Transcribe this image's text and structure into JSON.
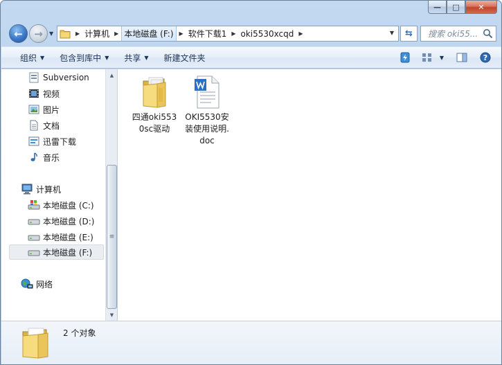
{
  "window": {
    "caption_buttons": {
      "minimize": "—",
      "maximize": "□",
      "close": "✕"
    }
  },
  "address_bar": {
    "breadcrumbs": [
      "计算机",
      "本地磁盘 (F:)",
      "软件下载1",
      "oki5530xcqd"
    ]
  },
  "search": {
    "placeholder": "搜索 oki55..."
  },
  "toolbar": {
    "organize": "组织",
    "include_in_library": "包含到库中",
    "share": "共享",
    "new_folder": "新建文件夹"
  },
  "nav_pane": {
    "items": [
      {
        "label": "Subversion",
        "icon": "subversion-icon"
      },
      {
        "label": "视频",
        "icon": "video-icon"
      },
      {
        "label": "图片",
        "icon": "pictures-icon"
      },
      {
        "label": "文档",
        "icon": "documents-icon"
      },
      {
        "label": "迅雷下载",
        "icon": "thunder-download-icon"
      },
      {
        "label": "音乐",
        "icon": "music-icon"
      },
      {
        "label": "计算机",
        "icon": "computer-icon"
      },
      {
        "label": "本地磁盘 (C:)",
        "icon": "system-drive-icon"
      },
      {
        "label": "本地磁盘 (D:)",
        "icon": "drive-icon"
      },
      {
        "label": "本地磁盘 (E:)",
        "icon": "drive-icon"
      },
      {
        "label": "本地磁盘 (F:)",
        "icon": "drive-icon",
        "selected": true
      },
      {
        "label": "网络",
        "icon": "network-icon"
      }
    ]
  },
  "files": [
    {
      "label": "四通oki5530sc驱动",
      "type": "folder",
      "icon": "folder-icon"
    },
    {
      "label": "OKI5530安装使用说明.doc",
      "type": "doc",
      "icon": "word-document-icon"
    }
  ],
  "details": {
    "item_count": "2 个对象"
  },
  "colors": {
    "selection_bg": "#eaeef3",
    "toolbar_text": "#1e3354",
    "accent_blue": "#3c7ac7"
  }
}
